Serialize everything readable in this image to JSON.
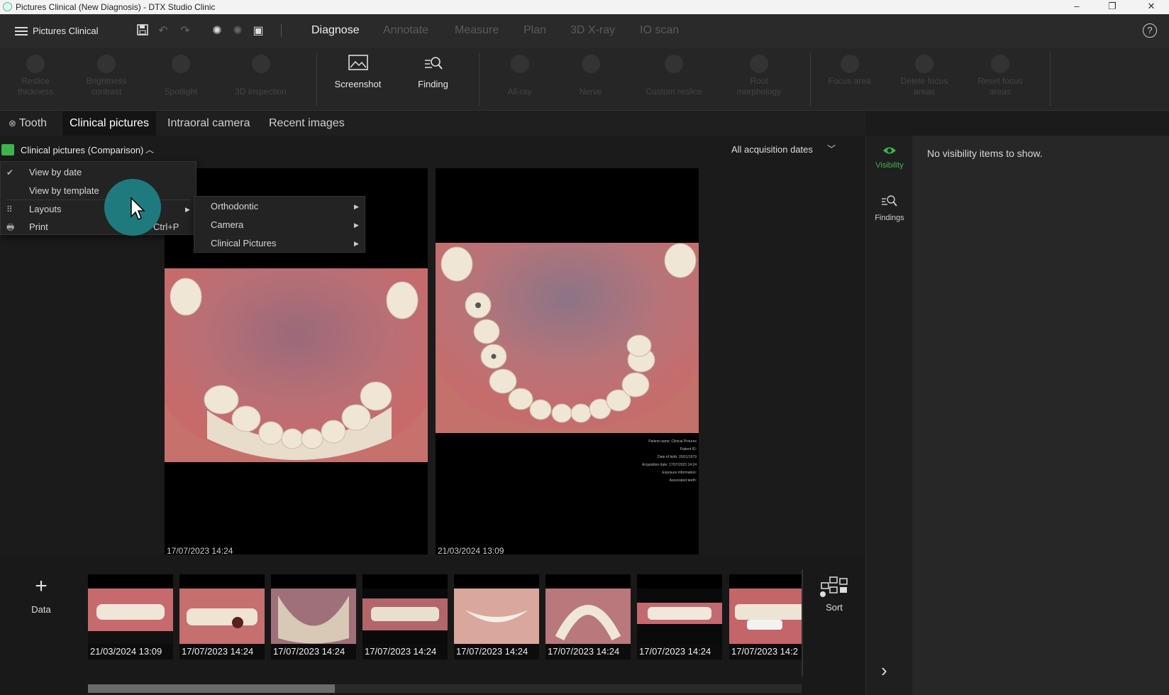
{
  "window": {
    "title": "Pictures Clinical (New Diagnosis) - DTX Studio Clinic",
    "minimize": "–",
    "maximize": "❐",
    "close": "✕"
  },
  "menubar": {
    "menu_label": "Pictures Clinical",
    "nav": [
      "Diagnose",
      "Annotate",
      "Measure",
      "Plan",
      "3D X-ray",
      "IO scan"
    ],
    "help": "?"
  },
  "ribbon": {
    "tools_left": [
      "Reslice thickness",
      "Brightness contrast",
      "Spotlight",
      "3D inspection"
    ],
    "screenshot": "Screenshot",
    "finding": "Finding",
    "tools_mid": [
      "All-ray",
      "Nerve",
      "Custom reslice",
      "Root morphology"
    ],
    "tools_right": [
      "Focus area",
      "Delete focus areas",
      "Reset focus areas"
    ]
  },
  "tabs": {
    "tooth": "Tooth",
    "clinical": "Clinical pictures",
    "intraoral": "Intraoral camera",
    "recent": "Recent images"
  },
  "viewer": {
    "header": "Clinical pictures (Comparison)",
    "date_filter": "All acquisition dates",
    "left_date": "17/07/2023 14:24",
    "right_date": "21/03/2024 13:09",
    "info_lines": [
      "Patient name: Clinical Pictures",
      "Patient ID:",
      "Date of birth: 20/01/1979",
      "Acquisition date: 17/07/2023 14:24",
      "Exposure information:",
      "Associated teeth:"
    ]
  },
  "dropdown": {
    "view_by_date": "View by date",
    "view_by_template": "View by template",
    "layouts": "Layouts",
    "print": "Print",
    "print_shortcut": "Ctrl+P",
    "check": "✔"
  },
  "submenu": [
    "Orthodontic",
    "Camera",
    "Clinical Pictures"
  ],
  "sidestrip": {
    "visibility": "Visibility",
    "findings": "Findings"
  },
  "rightpanel": {
    "empty": "No visibility items to show."
  },
  "filmstrip": {
    "add_label": "Data",
    "add_icon": "+",
    "sort_label": "Sort",
    "thumb_dates": [
      "21/03/2024 13:09",
      "17/07/2023 14:24",
      "17/07/2023 14:24",
      "17/07/2023 14:24",
      "17/07/2023 14:24",
      "17/07/2023 14:24",
      "17/07/2023 14:24",
      "17/07/2023 14:2"
    ],
    "next": "›"
  },
  "colors": {
    "accent_green": "#3fb34f",
    "cursor_highlight": "#1f8a8e"
  }
}
